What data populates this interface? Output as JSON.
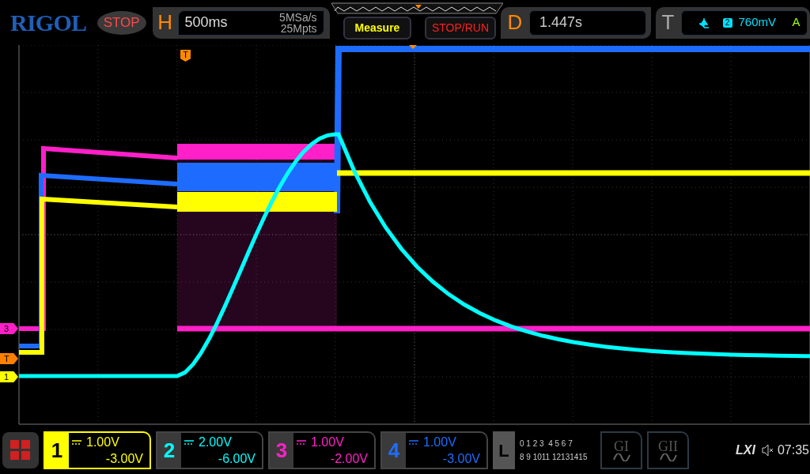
{
  "header": {
    "logo": "RIGOL",
    "run_status": "STOP",
    "horizontal": {
      "label": "H",
      "timebase": "500ms",
      "sample_rate": "5MSa/s",
      "memory_depth": "25Mpts"
    },
    "measure_button": "Measure",
    "stop_run_button": "STOP/RUN",
    "delay": {
      "label": "D",
      "value": "1.447s"
    },
    "trigger": {
      "label": "T",
      "source": "2",
      "level": "760mV",
      "mode": "A"
    }
  },
  "display": {
    "trigger_position_marker": "T",
    "markers": [
      {
        "label": "3",
        "color": "#ff20c8"
      },
      {
        "label": "T",
        "color": "#ff8000"
      },
      {
        "label": "1",
        "color": "#ffff00"
      }
    ]
  },
  "channels": [
    {
      "number": "1",
      "scale": "1.00V",
      "offset": "-3.00V",
      "color": "#ffff00",
      "selected": true
    },
    {
      "number": "2",
      "scale": "2.00V",
      "offset": "-6.00V",
      "color": "#00ffff",
      "selected": false
    },
    {
      "number": "3",
      "scale": "1.00V",
      "offset": "-2.00V",
      "color": "#ff20c8",
      "selected": false
    },
    {
      "number": "4",
      "scale": "1.00V",
      "offset": "-3.00V",
      "color": "#1e6cff",
      "selected": false
    }
  ],
  "logic": {
    "label": "L",
    "bits_row_1": "0 1 2 3  4 5 6 7",
    "bits_row_2": "8 9 1011 12131415"
  },
  "generators": [
    {
      "label": "GI"
    },
    {
      "label": "GII"
    }
  ],
  "status": {
    "lxi": "LXI",
    "time": "07:35"
  }
}
